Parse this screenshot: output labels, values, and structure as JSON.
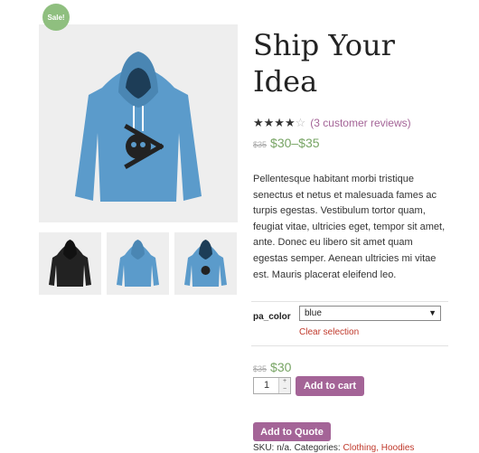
{
  "product": {
    "sale_badge": "Sale!",
    "title": "Ship Your Idea",
    "rating": {
      "value": 4,
      "max": 5
    },
    "reviews_link": "(3 customer reviews)",
    "price_old": "$35",
    "price_range": "$30–$35",
    "description": "Pellentesque habitant morbi tristique senectus et netus et malesuada fames ac turpis egestas. Vestibulum tortor quam, feugiat vitae, ultricies eget, tempor sit amet, ante. Donec eu libero sit amet quam egestas semper. Aenean ultricies mi vitae est. Mauris placerat eleifend leo."
  },
  "variation": {
    "label": "pa_color",
    "selected": "blue",
    "clear_link": "Clear selection",
    "price_old": "$35",
    "price": "$30"
  },
  "cart": {
    "quantity": "1",
    "add_to_cart_label": "Add to cart",
    "add_to_quote_label": "Add to Quote"
  },
  "meta": {
    "text": "SKU: n/a. Categories: ",
    "category": "Clothing, Hoodies"
  },
  "colors": {
    "accent": "#a46497",
    "price_green": "#77a464",
    "sale_badge": "#8fbf7f",
    "hoodie_blue": "#5b9bcb"
  }
}
